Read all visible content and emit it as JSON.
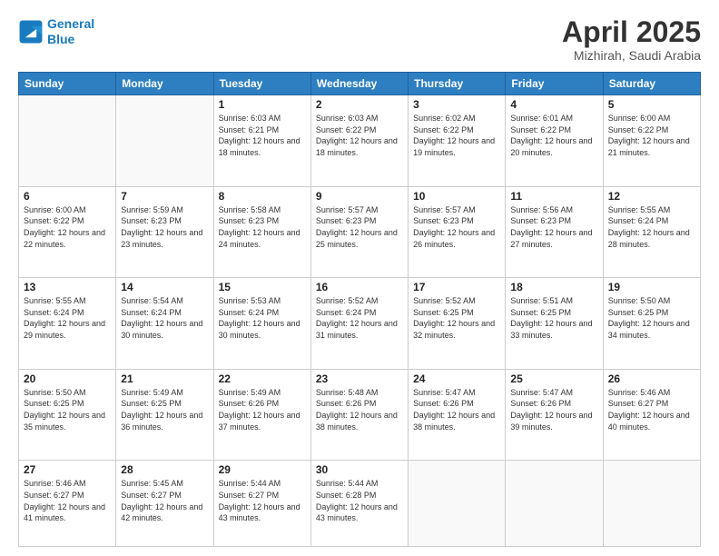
{
  "logo": {
    "line1": "General",
    "line2": "Blue"
  },
  "header": {
    "title": "April 2025",
    "subtitle": "Mizhirah, Saudi Arabia"
  },
  "weekdays": [
    "Sunday",
    "Monday",
    "Tuesday",
    "Wednesday",
    "Thursday",
    "Friday",
    "Saturday"
  ],
  "weeks": [
    [
      {
        "day": "",
        "info": ""
      },
      {
        "day": "",
        "info": ""
      },
      {
        "day": "1",
        "info": "Sunrise: 6:03 AM\nSunset: 6:21 PM\nDaylight: 12 hours and 18 minutes."
      },
      {
        "day": "2",
        "info": "Sunrise: 6:03 AM\nSunset: 6:22 PM\nDaylight: 12 hours and 18 minutes."
      },
      {
        "day": "3",
        "info": "Sunrise: 6:02 AM\nSunset: 6:22 PM\nDaylight: 12 hours and 19 minutes."
      },
      {
        "day": "4",
        "info": "Sunrise: 6:01 AM\nSunset: 6:22 PM\nDaylight: 12 hours and 20 minutes."
      },
      {
        "day": "5",
        "info": "Sunrise: 6:00 AM\nSunset: 6:22 PM\nDaylight: 12 hours and 21 minutes."
      }
    ],
    [
      {
        "day": "6",
        "info": "Sunrise: 6:00 AM\nSunset: 6:22 PM\nDaylight: 12 hours and 22 minutes."
      },
      {
        "day": "7",
        "info": "Sunrise: 5:59 AM\nSunset: 6:23 PM\nDaylight: 12 hours and 23 minutes."
      },
      {
        "day": "8",
        "info": "Sunrise: 5:58 AM\nSunset: 6:23 PM\nDaylight: 12 hours and 24 minutes."
      },
      {
        "day": "9",
        "info": "Sunrise: 5:57 AM\nSunset: 6:23 PM\nDaylight: 12 hours and 25 minutes."
      },
      {
        "day": "10",
        "info": "Sunrise: 5:57 AM\nSunset: 6:23 PM\nDaylight: 12 hours and 26 minutes."
      },
      {
        "day": "11",
        "info": "Sunrise: 5:56 AM\nSunset: 6:23 PM\nDaylight: 12 hours and 27 minutes."
      },
      {
        "day": "12",
        "info": "Sunrise: 5:55 AM\nSunset: 6:24 PM\nDaylight: 12 hours and 28 minutes."
      }
    ],
    [
      {
        "day": "13",
        "info": "Sunrise: 5:55 AM\nSunset: 6:24 PM\nDaylight: 12 hours and 29 minutes."
      },
      {
        "day": "14",
        "info": "Sunrise: 5:54 AM\nSunset: 6:24 PM\nDaylight: 12 hours and 30 minutes."
      },
      {
        "day": "15",
        "info": "Sunrise: 5:53 AM\nSunset: 6:24 PM\nDaylight: 12 hours and 30 minutes."
      },
      {
        "day": "16",
        "info": "Sunrise: 5:52 AM\nSunset: 6:24 PM\nDaylight: 12 hours and 31 minutes."
      },
      {
        "day": "17",
        "info": "Sunrise: 5:52 AM\nSunset: 6:25 PM\nDaylight: 12 hours and 32 minutes."
      },
      {
        "day": "18",
        "info": "Sunrise: 5:51 AM\nSunset: 6:25 PM\nDaylight: 12 hours and 33 minutes."
      },
      {
        "day": "19",
        "info": "Sunrise: 5:50 AM\nSunset: 6:25 PM\nDaylight: 12 hours and 34 minutes."
      }
    ],
    [
      {
        "day": "20",
        "info": "Sunrise: 5:50 AM\nSunset: 6:25 PM\nDaylight: 12 hours and 35 minutes."
      },
      {
        "day": "21",
        "info": "Sunrise: 5:49 AM\nSunset: 6:25 PM\nDaylight: 12 hours and 36 minutes."
      },
      {
        "day": "22",
        "info": "Sunrise: 5:49 AM\nSunset: 6:26 PM\nDaylight: 12 hours and 37 minutes."
      },
      {
        "day": "23",
        "info": "Sunrise: 5:48 AM\nSunset: 6:26 PM\nDaylight: 12 hours and 38 minutes."
      },
      {
        "day": "24",
        "info": "Sunrise: 5:47 AM\nSunset: 6:26 PM\nDaylight: 12 hours and 38 minutes."
      },
      {
        "day": "25",
        "info": "Sunrise: 5:47 AM\nSunset: 6:26 PM\nDaylight: 12 hours and 39 minutes."
      },
      {
        "day": "26",
        "info": "Sunrise: 5:46 AM\nSunset: 6:27 PM\nDaylight: 12 hours and 40 minutes."
      }
    ],
    [
      {
        "day": "27",
        "info": "Sunrise: 5:46 AM\nSunset: 6:27 PM\nDaylight: 12 hours and 41 minutes."
      },
      {
        "day": "28",
        "info": "Sunrise: 5:45 AM\nSunset: 6:27 PM\nDaylight: 12 hours and 42 minutes."
      },
      {
        "day": "29",
        "info": "Sunrise: 5:44 AM\nSunset: 6:27 PM\nDaylight: 12 hours and 43 minutes."
      },
      {
        "day": "30",
        "info": "Sunrise: 5:44 AM\nSunset: 6:28 PM\nDaylight: 12 hours and 43 minutes."
      },
      {
        "day": "",
        "info": ""
      },
      {
        "day": "",
        "info": ""
      },
      {
        "day": "",
        "info": ""
      }
    ]
  ]
}
